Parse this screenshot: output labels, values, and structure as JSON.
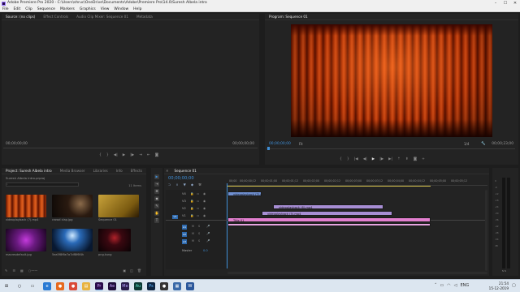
{
  "window": {
    "title": "Adobe Premiere Pro 2020 - C:\\Users\\shruc\\OneDrive\\Documents\\Adobe\\Premiere Pro\\14.0\\Suresh Albela intro",
    "controls": [
      "–",
      "☐",
      "✕"
    ]
  },
  "menu": [
    "File",
    "Edit",
    "Clip",
    "Sequence",
    "Markers",
    "Graphics",
    "View",
    "Window",
    "Help"
  ],
  "source_panel": {
    "tabs": [
      "Source: (no clips)",
      "Effect Controls",
      "Audio Clip Mixer: Sequence 01",
      "Metadata"
    ],
    "timecode_left": "00;00;00;00",
    "timecode_right": "00;00;00;00"
  },
  "program_panel": {
    "tab": "Program: Sequence 01",
    "timecode_left": "00;00;00;00",
    "fit": "Fit",
    "resolution": "1/4",
    "timecode_right": "00;00;23;00"
  },
  "project_panel": {
    "tabs": [
      "Project: Suresh Albela intro",
      "Media Browser",
      "Libraries",
      "Info",
      "Effects"
    ],
    "project_file": "Suresh Albela intro.prproj",
    "item_count": "11 Items",
    "items": [
      {
        "label": "videoplayback (7).mp4",
        "kind": "curtain"
      },
      {
        "label": "crowd clap.jpg",
        "kind": "crowd"
      },
      {
        "label": "Sequence 01",
        "kind": "sequence"
      },
      {
        "label": "maxresdefault.jpg",
        "kind": "purple"
      },
      {
        "label": "5ea5f8f6e7a7df8f6f4h",
        "kind": "concert"
      },
      {
        "label": "png-kung",
        "kind": "stage"
      }
    ]
  },
  "timeline": {
    "tab": "Sequence 01",
    "timecode": "00;00;00;00",
    "ruler": [
      "00;00",
      "00;00;00;12",
      "00;00;01;00",
      "00;00;01;12",
      "00;00;02;00",
      "00;00;02;12",
      "00;00;03;00",
      "00;00;03;12",
      "00;00;04;00",
      "00;00;04;12",
      "00;00;05;00",
      "00;00;05;12"
    ],
    "video_tracks": [
      "V4",
      "V3",
      "V2",
      "V1"
    ],
    "audio_tracks": [
      "A1",
      "A2",
      "A3"
    ],
    "master_label": "Master",
    "master_value": "0.0",
    "clips": [
      {
        "label": "videoplayback (7).mp4",
        "color": "#6f8fd0"
      },
      {
        "label": "videoplayback (6).mp4",
        "color": "#a78ed4"
      },
      {
        "label": "videoplayback (5).mp4",
        "color": "#a78ed4"
      },
      {
        "label": "Title 01",
        "color": "#e27fcf"
      },
      {
        "label": "",
        "color": "#e6a4df"
      }
    ]
  },
  "tools": [
    "▶",
    "⇥",
    "✥",
    "◆",
    "✎",
    "✋",
    "T"
  ],
  "taskbar": {
    "time": "21:54",
    "date": "15-12-2019",
    "icons": [
      {
        "name": "windows",
        "glyph": "⊞",
        "color": "#1f1f1f"
      },
      {
        "name": "search",
        "glyph": "○",
        "color": "#1f1f1f"
      },
      {
        "name": "task-view",
        "glyph": "▭",
        "color": "#1f1f1f"
      },
      {
        "name": "edge",
        "glyph": "e",
        "color": "#2a7bd4"
      },
      {
        "name": "firefox",
        "glyph": "●",
        "color": "#e66a1f"
      },
      {
        "name": "chrome",
        "glyph": "●",
        "color": "#d94a38"
      },
      {
        "name": "explorer",
        "glyph": "▤",
        "color": "#e8b341"
      },
      {
        "name": "premiere",
        "glyph": "Pr",
        "color": "#2a0d4a"
      },
      {
        "name": "after-effects",
        "glyph": "Ae",
        "color": "#1f0d3a"
      },
      {
        "name": "media-encoder",
        "glyph": "Me",
        "color": "#2a1d4a"
      },
      {
        "name": "audition",
        "glyph": "Au",
        "color": "#0d3a34"
      },
      {
        "name": "photoshop",
        "glyph": "Ps",
        "color": "#0d2440"
      },
      {
        "name": "obs",
        "glyph": "●",
        "color": "#333"
      },
      {
        "name": "store",
        "glyph": "▦",
        "color": "#3a6aa8"
      },
      {
        "name": "word",
        "glyph": "W",
        "color": "#2b579a"
      }
    ]
  }
}
